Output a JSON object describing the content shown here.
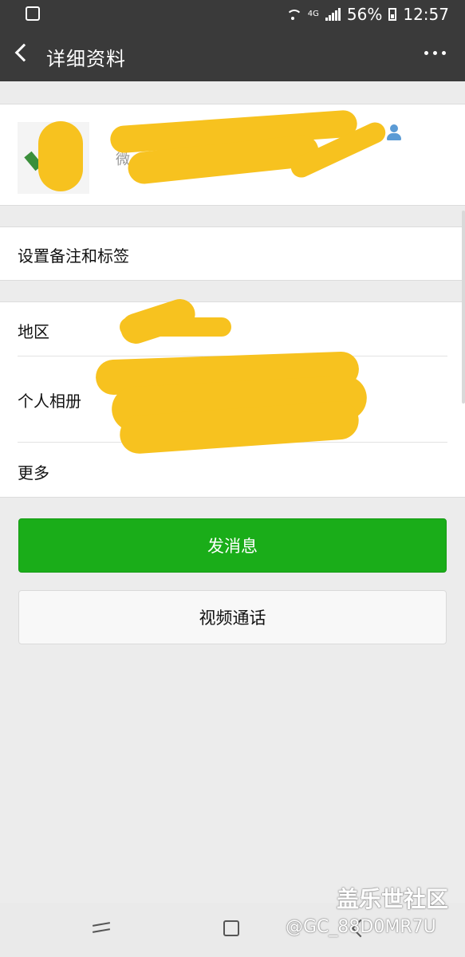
{
  "status_bar": {
    "battery": "56%",
    "time": "12:57",
    "network": "4G"
  },
  "header": {
    "title": "详细资料"
  },
  "profile": {
    "sub_label": "微"
  },
  "rows": {
    "remark_tags": "设置备注和标签",
    "region": "地区",
    "album": "个人相册",
    "more": "更多"
  },
  "buttons": {
    "send_message": "发消息",
    "video_call": "视频通话"
  },
  "watermark": {
    "site": "盖乐世社区",
    "user": "@GC_88D0MR7U"
  },
  "colors": {
    "nav_bg": "#3a3a3a",
    "page_bg": "#ececec",
    "primary_green": "#1aad19",
    "redaction_yellow": "#f7c21f"
  }
}
